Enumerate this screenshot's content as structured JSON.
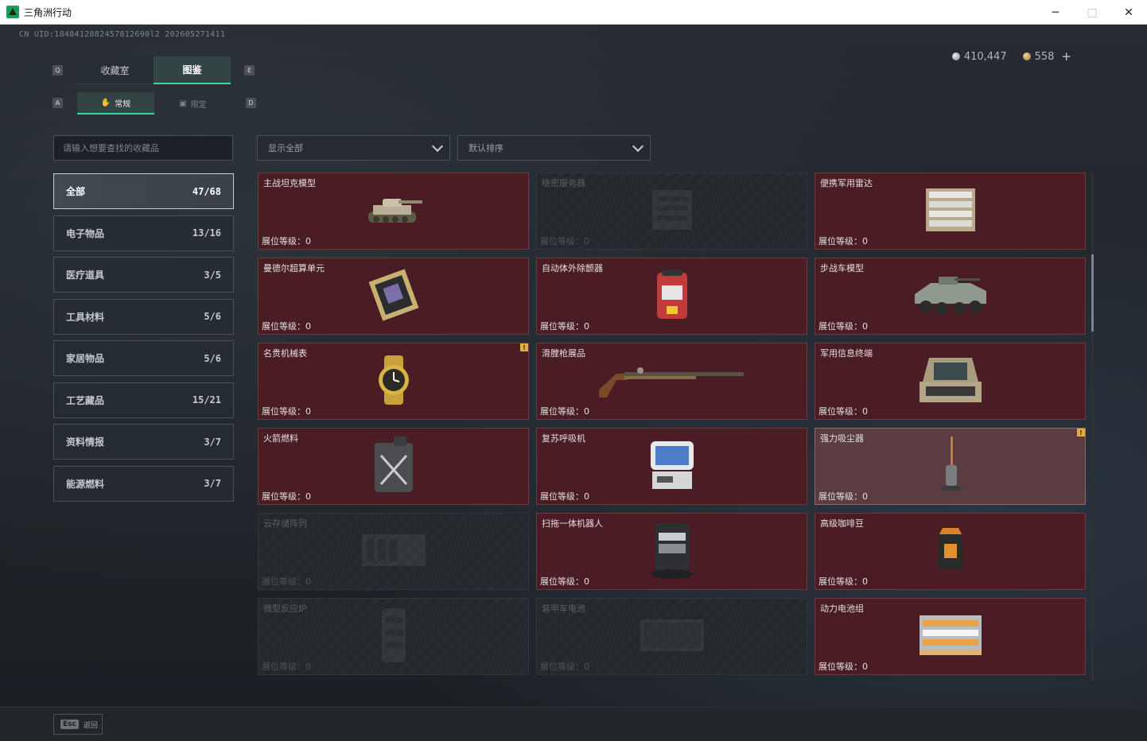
{
  "window": {
    "title": "三角洲行动",
    "controls": {
      "minimize": "─",
      "maximize": "□",
      "close": "✕"
    }
  },
  "header": {
    "uid": "CN UID:1848412882457812690l2 202605271411",
    "currency": [
      {
        "icon": "silver-coin-icon",
        "value": "410,447"
      },
      {
        "icon": "gold-coin-icon",
        "value": "558"
      }
    ],
    "plus": "+"
  },
  "keyhints": {
    "tab_left": "Q",
    "tab_right": "E",
    "sub_left": "A",
    "sub_right": "D"
  },
  "tabs": [
    {
      "label": "收藏室",
      "active": false
    },
    {
      "label": "图鉴",
      "active": true
    }
  ],
  "subtabs": [
    {
      "label": "常规",
      "icon": "hand-icon",
      "active": true
    },
    {
      "label": "限定",
      "icon": "image-icon",
      "active": false
    }
  ],
  "search": {
    "placeholder": "请输入想要查找的收藏品"
  },
  "filters": {
    "show": "显示全部",
    "sort": "默认排序"
  },
  "categories": [
    {
      "label": "全部",
      "count": "47/68",
      "active": true
    },
    {
      "label": "电子物品",
      "count": "13/16"
    },
    {
      "label": "医疗道具",
      "count": "3/5"
    },
    {
      "label": "工具材料",
      "count": "5/6"
    },
    {
      "label": "家居物品",
      "count": "5/6"
    },
    {
      "label": "工艺藏品",
      "count": "15/21"
    },
    {
      "label": "资料情报",
      "count": "3/7"
    },
    {
      "label": "能源燃料",
      "count": "3/7"
    }
  ],
  "items": [
    {
      "name": "主战坦克模型",
      "level": "展位等级：0",
      "owned": true,
      "icon": "tank-icon"
    },
    {
      "name": "绝密服务器",
      "level": "展位等级：0",
      "owned": false,
      "icon": "server-icon"
    },
    {
      "name": "便携军用雷达",
      "level": "展位等级：0",
      "owned": true,
      "icon": "radar-icon"
    },
    {
      "name": "曼德尔超算单元",
      "level": "展位等级：0",
      "owned": true,
      "icon": "chip-icon"
    },
    {
      "name": "自动体外除颤器",
      "level": "展位等级：0",
      "owned": true,
      "icon": "defibrillator-icon"
    },
    {
      "name": "步战车模型",
      "level": "展位等级：0",
      "owned": true,
      "icon": "ifv-icon"
    },
    {
      "name": "名贵机械表",
      "level": "展位等级：0",
      "owned": true,
      "icon": "watch-icon",
      "badge": "!"
    },
    {
      "name": "滑膛枪展品",
      "level": "展位等级：0",
      "owned": true,
      "icon": "musket-icon"
    },
    {
      "name": "军用信息终端",
      "level": "展位等级：0",
      "owned": true,
      "icon": "terminal-icon"
    },
    {
      "name": "火箭燃料",
      "level": "展位等级：0",
      "owned": true,
      "icon": "fuel-can-icon"
    },
    {
      "name": "复苏呼吸机",
      "level": "展位等级：0",
      "owned": true,
      "icon": "ventilator-icon"
    },
    {
      "name": "强力吸尘器",
      "level": "展位等级：0",
      "owned": true,
      "icon": "vacuum-icon",
      "badge": "!",
      "highlight": true
    },
    {
      "name": "云存储阵列",
      "level": "展位等级：0",
      "owned": false,
      "icon": "storage-icon"
    },
    {
      "name": "扫拖一体机器人",
      "level": "展位等级：0",
      "owned": true,
      "icon": "robot-vacuum-icon"
    },
    {
      "name": "高级咖啡豆",
      "level": "展位等级：0",
      "owned": true,
      "icon": "coffee-bag-icon"
    },
    {
      "name": "微型反应炉",
      "level": "展位等级：0",
      "owned": false,
      "icon": "reactor-icon"
    },
    {
      "name": "装甲车电池",
      "level": "展位等级：0",
      "owned": false,
      "icon": "battery-icon"
    },
    {
      "name": "动力电池组",
      "level": "展位等级：0",
      "owned": true,
      "icon": "battery-pack-icon"
    }
  ],
  "footer": {
    "key": "Esc",
    "label": "返回"
  },
  "colors": {
    "owned_card": "#4a1c24",
    "accent": "#39d7a0",
    "badge": "#e0b23a"
  }
}
